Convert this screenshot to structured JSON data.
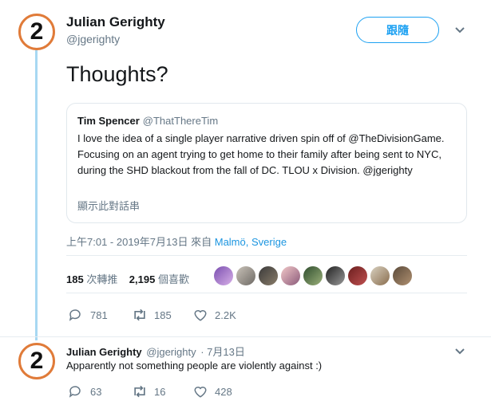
{
  "main_tweet": {
    "author_name": "Julian Gerighty",
    "author_handle": "@jgerighty",
    "avatar_text": "2",
    "follow_label": "跟隨",
    "text": "Thoughts?",
    "quote": {
      "author_name": "Tim Spencer",
      "author_handle": "@ThatThereTim",
      "text": "I love the idea of a single player narrative driven spin off of @TheDivisionGame. Focusing on an agent trying to get home to their family after being sent to NYC, during the SHD blackout from the fall of DC. TLOU x Division. @jgerighty",
      "show_thread": "顯示此對話串"
    },
    "timestamp": "上午7:01 - 2019年7月13日",
    "from_label": "來自",
    "location": "Malmö, Sverige",
    "retweet_count": "185",
    "retweet_label": "次轉推",
    "like_count": "2,195",
    "like_label": "個喜歡",
    "actions": {
      "replies": "781",
      "retweets": "185",
      "likes": "2.2K"
    }
  },
  "reply_tweet": {
    "author_name": "Julian Gerighty",
    "author_handle": "@jgerighty",
    "date": "· 7月13日",
    "avatar_text": "2",
    "text": "Apparently not something people are violently against :)",
    "actions": {
      "replies": "63",
      "retweets": "16",
      "likes": "428"
    }
  },
  "colors": {
    "accent": "#1da1f2",
    "avatar_ring": "#e07b39",
    "thread_line": "#a7d8f2",
    "muted": "#657786"
  }
}
